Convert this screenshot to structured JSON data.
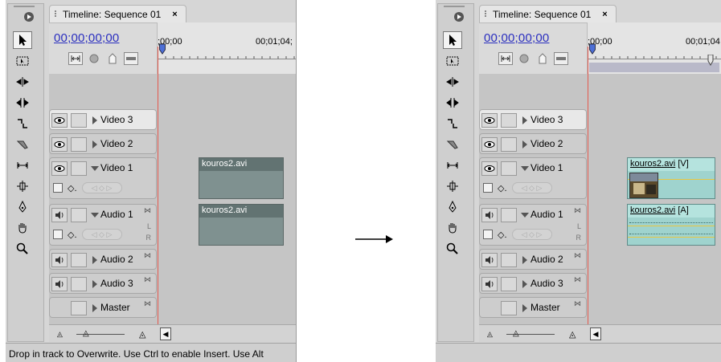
{
  "before": {
    "tab_title": "Timeline: Sequence 01",
    "tab_close": "×",
    "timecode": "00;00;00;00",
    "ruler_start": ";00;00",
    "ruler_end": "00;01;04;",
    "tracks": [
      {
        "name": "Video 3"
      },
      {
        "name": "Video 2"
      },
      {
        "name": "Video 1"
      },
      {
        "name": "Audio 1"
      },
      {
        "name": "Audio 2"
      },
      {
        "name": "Audio 3"
      },
      {
        "name": "Master"
      }
    ],
    "clip_video": "kouros2.avi",
    "clip_audio": "kouros2.avi",
    "status": "Drop in track to Overwrite. Use Ctrl to enable Insert. Use Alt"
  },
  "after": {
    "tab_title": "Timeline: Sequence 01",
    "tab_close": "×",
    "timecode": "00;00;00;00",
    "ruler_start": ";00;00",
    "ruler_end": "00;01;04",
    "tracks": [
      {
        "name": "Video 3"
      },
      {
        "name": "Video 2"
      },
      {
        "name": "Video 1"
      },
      {
        "name": "Audio 1"
      },
      {
        "name": "Audio 2"
      },
      {
        "name": "Audio 3"
      },
      {
        "name": "Master"
      }
    ],
    "clip_video_name": "kouros2.avi",
    "clip_video_tag": " [V]",
    "clip_audio_name": "kouros2.avi",
    "clip_audio_tag": " [A]",
    "status": ""
  },
  "labels": {
    "lr_left": "L",
    "lr_right": "R"
  },
  "icons": [
    "selection-tool-icon",
    "track-select-tool-icon",
    "ripple-edit-tool-icon",
    "rolling-edit-tool-icon",
    "rate-stretch-tool-icon",
    "razor-tool-icon",
    "slip-tool-icon",
    "slide-tool-icon",
    "pen-tool-icon",
    "hand-tool-icon",
    "zoom-tool-icon"
  ],
  "colors": {
    "timecode": "#2b2fbf",
    "playhead": "#e45a4e",
    "clip_before": "#7f9190",
    "clip_after": "#9fd3ce"
  }
}
